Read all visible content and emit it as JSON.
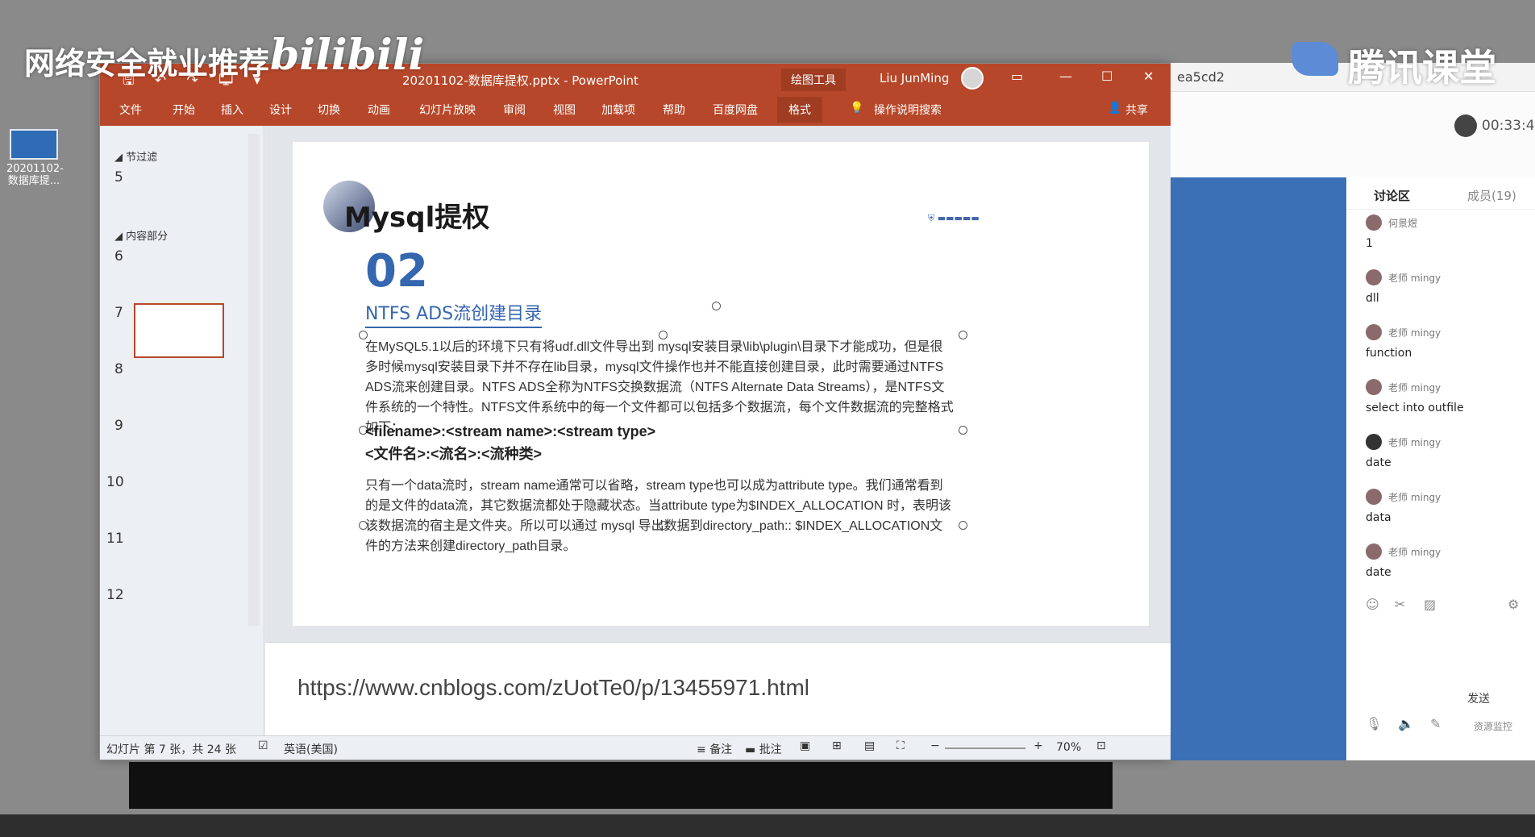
{
  "overlay": {
    "left_watermark": "网络安全就业推荐",
    "bilibili": "bilibili",
    "right_watermark": "腾讯课堂"
  },
  "desktop": {
    "icon_label": "20201102-数据库提..."
  },
  "ppt": {
    "title": "20201102-数据库提权.pptx  -  PowerPoint",
    "context_tool": "绘图工具",
    "user": "Liu JunMing",
    "qat": "🖫 ↶ ↷ 🖵 ▾",
    "tabs": [
      "文件",
      "开始",
      "插入",
      "设计",
      "切换",
      "动画",
      "幻灯片放映",
      "审阅",
      "视图",
      "加载项",
      "帮助",
      "百度网盘",
      "格式"
    ],
    "search": "操作说明搜索",
    "share": "共享",
    "sections": [
      {
        "label": "节过滤"
      },
      {
        "label": "内容部分"
      }
    ],
    "slide_numbers": [
      "5",
      "6",
      "7",
      "8",
      "9",
      "10",
      "11",
      "12"
    ],
    "slide": {
      "title": "Mysql提权",
      "number": "02",
      "subtitle": "NTFS ADS流创建目录",
      "para1": "在MySQL5.1以后的环境下只有将udf.dll文件导出到 mysql安装目录\\lib\\plugin\\目录下才能成功，但是很多时候mysql安装目录下并不存在lib目录，mysql文件操作也并不能直接创建目录，此时需要通过NTFS ADS流来创建目录。NTFS ADS全称为NTFS交换数据流（NTFS Alternate Data Streams），是NTFS文件系统的一个特性。NTFS文件系统中的每一个文件都可以包括多个数据流，每个文件数据流的完整格式如下：",
      "format_en": "<filename>:<stream name>:<stream type>",
      "format_cn": "<文件名>:<流名>:<流种类>",
      "para2": "只有一个data流时，stream name通常可以省略，stream type也可以成为attribute type。我们通常看到的是文件的data流，其它数据流都处于隐藏状态。当attribute type为$INDEX_ALLOCATION 时，表明该该数据流的宿主是文件夹。所以可以通过 mysql 导出数据到directory_path:: $INDEX_ALLOCATION文件的方法来创建directory_path目录。"
    },
    "notes_text": "https://www.cnblogs.com/zUotTe0/p/13455971.html",
    "status": {
      "slide_info": "幻灯片 第 7 张，共 24 张",
      "lang": "英语(美国)",
      "notes_btn": "备注",
      "comments_btn": "批注",
      "zoom": "70%"
    }
  },
  "chat": {
    "top_text": "ea5cd2",
    "timer": "00:33:4",
    "tab_discussion": "讨论区",
    "tab_members": "成员(19)",
    "messages": [
      {
        "name": "何景煜",
        "text": "1"
      },
      {
        "name": "老师  mingy",
        "text": "dll"
      },
      {
        "name": "老师  mingy",
        "text": "function"
      },
      {
        "name": "老师  mingy",
        "text": "select into outfile"
      },
      {
        "name": "老师  mingy",
        "text": "date"
      },
      {
        "name": "老师  mingy",
        "text": "data"
      },
      {
        "name": "老师  mingy",
        "text": "date"
      }
    ],
    "send": "发送",
    "monitor": "资源监控"
  }
}
